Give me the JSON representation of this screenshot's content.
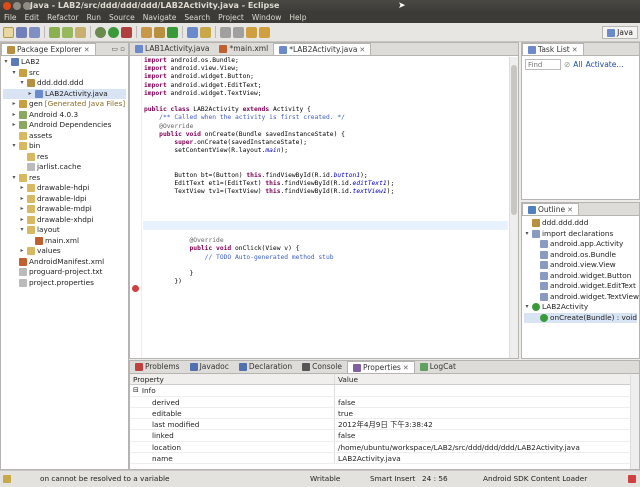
{
  "window": {
    "title": "Java - LAB2/src/ddd/ddd/ddd/LAB2Activity.java - Eclipse"
  },
  "menu": [
    "File",
    "Edit",
    "Refactor",
    "Run",
    "Source",
    "Navigate",
    "Search",
    "Project",
    "Window",
    "Help"
  ],
  "perspective": {
    "label": "Java"
  },
  "package_explorer": {
    "tab_label": "Package Explorer",
    "tree": [
      {
        "label": "LAB2",
        "depth": 0,
        "arrow": "▾",
        "icon": "project-icon",
        "color": "#5a7ab8"
      },
      {
        "label": "src",
        "depth": 1,
        "arrow": "▾",
        "icon": "source-folder-icon",
        "color": "#c8a040"
      },
      {
        "label": "ddd.ddd.ddd",
        "depth": 2,
        "arrow": "▾",
        "icon": "package-icon",
        "color": "#b89040"
      },
      {
        "label": "LAB2Activity.java",
        "depth": 3,
        "arrow": "▸",
        "icon": "java-file-icon",
        "color": "#6a8acb",
        "selected": true
      },
      {
        "label": "gen",
        "extra": "[Generated Java Files]",
        "depth": 1,
        "arrow": "▸",
        "icon": "source-folder-icon",
        "color": "#c8a040"
      },
      {
        "label": "Android 4.0.3",
        "depth": 1,
        "arrow": "▸",
        "icon": "library-icon",
        "color": "#8aa860"
      },
      {
        "label": "Android Dependencies",
        "depth": 1,
        "arrow": "▸",
        "icon": "library-icon",
        "color": "#8aa860"
      },
      {
        "label": "assets",
        "depth": 1,
        "arrow": "",
        "icon": "folder-icon",
        "color": "#d8b860"
      },
      {
        "label": "bin",
        "depth": 1,
        "arrow": "▾",
        "icon": "folder-icon",
        "color": "#d8b860"
      },
      {
        "label": "res",
        "depth": 2,
        "arrow": "",
        "icon": "folder-icon",
        "color": "#d8b860"
      },
      {
        "label": "jarlist.cache",
        "depth": 2,
        "arrow": "",
        "icon": "file-icon",
        "color": "#bbbbbb"
      },
      {
        "label": "res",
        "depth": 1,
        "arrow": "▾",
        "icon": "folder-icon",
        "color": "#d8b860"
      },
      {
        "label": "drawable-hdpi",
        "depth": 2,
        "arrow": "▸",
        "icon": "folder-icon",
        "color": "#d8b860"
      },
      {
        "label": "drawable-ldpi",
        "depth": 2,
        "arrow": "▸",
        "icon": "folder-icon",
        "color": "#d8b860"
      },
      {
        "label": "drawable-mdpi",
        "depth": 2,
        "arrow": "▸",
        "icon": "folder-icon",
        "color": "#d8b860"
      },
      {
        "label": "drawable-xhdpi",
        "depth": 2,
        "arrow": "▸",
        "icon": "folder-icon",
        "color": "#d8b860"
      },
      {
        "label": "layout",
        "depth": 2,
        "arrow": "▾",
        "icon": "folder-icon",
        "color": "#d8b860"
      },
      {
        "label": "main.xml",
        "depth": 3,
        "arrow": "",
        "icon": "xml-file-icon",
        "color": "#c06030"
      },
      {
        "label": "values",
        "depth": 2,
        "arrow": "▸",
        "icon": "folder-icon",
        "color": "#d8b860"
      },
      {
        "label": "AndroidManifest.xml",
        "depth": 1,
        "arrow": "",
        "icon": "xml-file-icon",
        "color": "#c06030"
      },
      {
        "label": "proguard-project.txt",
        "depth": 1,
        "arrow": "",
        "icon": "file-icon",
        "color": "#bbbbbb"
      },
      {
        "label": "project.properties",
        "depth": 1,
        "arrow": "",
        "icon": "file-icon",
        "color": "#bbbbbb"
      }
    ]
  },
  "editor": {
    "tabs": [
      {
        "label": "LAB1Activity.java",
        "active": false
      },
      {
        "label": "*main.xml",
        "active": false
      },
      {
        "label": "*LAB2Activity.java",
        "active": true
      }
    ],
    "code": [
      [
        [
          "kw",
          "import "
        ],
        [
          "",
          "android.os.Bundle;"
        ]
      ],
      [
        [
          "kw",
          "import "
        ],
        [
          "",
          "android.view.View;"
        ]
      ],
      [
        [
          "kw",
          "import "
        ],
        [
          "",
          "android.widget.Button;"
        ]
      ],
      [
        [
          "kw",
          "import "
        ],
        [
          "",
          "android.widget.EditText;"
        ]
      ],
      [
        [
          "kw",
          "import "
        ],
        [
          "",
          "android.widget.TextView;"
        ]
      ],
      [
        [
          "",
          ""
        ]
      ],
      [
        [
          "kw",
          "public class "
        ],
        [
          "",
          "LAB2Activity "
        ],
        [
          "kw",
          "extends "
        ],
        [
          "",
          "Activity {"
        ]
      ],
      [
        [
          "cm",
          "    /** Called when the activity is first created. */"
        ]
      ],
      [
        [
          "an",
          "    @Override"
        ]
      ],
      [
        [
          "kw",
          "    public void "
        ],
        [
          "",
          "onCreate(Bundle savedInstanceState) {"
        ]
      ],
      [
        [
          "kw",
          "        super"
        ],
        [
          "",
          ".onCreate(savedInstanceState);"
        ]
      ],
      [
        [
          "",
          "        setContentView(R.layout."
        ],
        [
          "fd",
          "main"
        ],
        [
          "",
          ");"
        ]
      ],
      [
        [
          "",
          ""
        ]
      ],
      [
        [
          "",
          ""
        ]
      ],
      [
        [
          "",
          "        Button bt=(Button) "
        ],
        [
          "kw",
          "this"
        ],
        [
          "",
          ".findViewById(R.id."
        ],
        [
          "fd",
          "button1"
        ],
        [
          "",
          ");"
        ]
      ],
      [
        [
          "",
          "        EditText et1=(EditText) "
        ],
        [
          "kw",
          "this"
        ],
        [
          "",
          ".findViewById(R.id."
        ],
        [
          "fd",
          "editText1"
        ],
        [
          "",
          ");"
        ]
      ],
      [
        [
          "",
          "        TextView tv1=(TextView) "
        ],
        [
          "kw",
          "this"
        ],
        [
          "",
          ".findViewById(R.id."
        ],
        [
          "fd",
          "textView1"
        ],
        [
          "",
          ");"
        ]
      ],
      [
        [
          "",
          ""
        ]
      ],
      [
        [
          "",
          ""
        ]
      ],
      [
        [
          "",
          ""
        ]
      ],
      [
        [
          "",
          "        bt.setOnClickListener("
        ],
        [
          "kw",
          "new "
        ],
        [
          "",
          "View.OnClickListener() {"
        ]
      ],
      [
        [
          "",
          ""
        ]
      ],
      [
        [
          "an",
          "            @Override"
        ]
      ],
      [
        [
          "kw",
          "            public void "
        ],
        [
          "",
          "onClick(View v) {"
        ]
      ],
      [
        [
          "cm",
          "                // TODO Auto-generated method stub"
        ]
      ],
      [
        [
          "",
          ""
        ]
      ],
      [
        [
          "",
          "            }"
        ]
      ],
      [
        [
          "",
          "        })"
        ]
      ]
    ]
  },
  "task_list": {
    "tab_label": "Task List",
    "find_placeholder": "Find",
    "filter_label": "All",
    "activate_label": "Activate..."
  },
  "outline": {
    "tab_label": "Outline",
    "items": [
      {
        "label": "ddd.ddd.ddd",
        "depth": 0,
        "icon": "package-icon",
        "color": "#b89040"
      },
      {
        "label": "import declarations",
        "depth": 0,
        "icon": "imports-icon",
        "color": "#8a9ac0",
        "arrow": "▾"
      },
      {
        "label": "android.app.Activity",
        "depth": 1,
        "icon": "import-icon",
        "color": "#8a9ac0"
      },
      {
        "label": "android.os.Bundle",
        "depth": 1,
        "icon": "import-icon",
        "color": "#8a9ac0"
      },
      {
        "label": "android.view.View",
        "depth": 1,
        "icon": "import-icon",
        "color": "#8a9ac0"
      },
      {
        "label": "android.widget.Button",
        "depth": 1,
        "icon": "import-icon",
        "color": "#8a9ac0"
      },
      {
        "label": "android.widget.EditText",
        "depth": 1,
        "icon": "import-icon",
        "color": "#8a9ac0"
      },
      {
        "label": "android.widget.TextView",
        "depth": 1,
        "icon": "import-icon",
        "color": "#8a9ac0"
      },
      {
        "label": "LAB2Activity",
        "depth": 0,
        "icon": "class-icon",
        "color": "#3a9a3a",
        "arrow": "▾"
      },
      {
        "label": "onCreate(Bundle) : void",
        "depth": 1,
        "icon": "method-icon",
        "color": "#3a9a3a",
        "selected": true
      }
    ]
  },
  "bottom": {
    "tabs": [
      {
        "label": "Problems",
        "icon": "problems-icon",
        "color": "#c04040"
      },
      {
        "label": "Javadoc",
        "icon": "javadoc-icon",
        "color": "#5070b0"
      },
      {
        "label": "Declaration",
        "icon": "declaration-icon",
        "color": "#5070b0"
      },
      {
        "label": "Console",
        "icon": "console-icon",
        "color": "#555555"
      },
      {
        "label": "Properties",
        "icon": "properties-icon",
        "color": "#8060a0",
        "active": true
      },
      {
        "label": "LogCat",
        "icon": "logcat-icon",
        "color": "#60a060"
      }
    ],
    "columns": [
      "Property",
      "Value"
    ],
    "group": "Info",
    "rows": [
      {
        "key": "derived",
        "value": "false"
      },
      {
        "key": "editable",
        "value": "true"
      },
      {
        "key": "last modified",
        "value": "2012年4月9日 下午3:38:42"
      },
      {
        "key": "linked",
        "value": "false"
      },
      {
        "key": "location",
        "value": "/home/ubuntu/workspace/LAB2/src/ddd/ddd/ddd/LAB2Activity.java"
      },
      {
        "key": "name",
        "value": "LAB2Activity.java"
      }
    ]
  },
  "status": {
    "message": "on cannot be resolved to a variable",
    "writable": "Writable",
    "insert": "Smart Insert",
    "position": "24 : 56",
    "loader": "Android SDK Content Loader"
  }
}
